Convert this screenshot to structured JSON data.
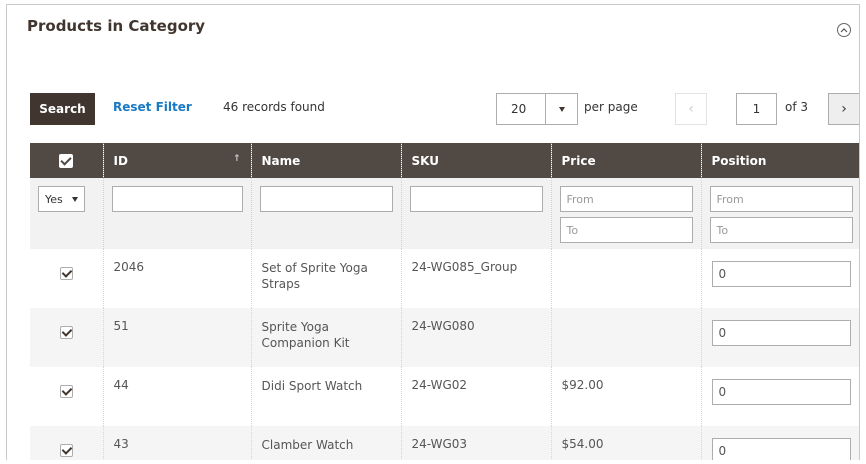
{
  "panel": {
    "title": "Products in Category"
  },
  "toolbar": {
    "search_label": "Search",
    "reset_label": "Reset Filter",
    "records_found": "46 records found",
    "per_page_value": "20",
    "per_page_label": "per page",
    "current_page": "1",
    "of_pages": "of 3"
  },
  "columns": [
    "ID",
    "Name",
    "SKU",
    "Price",
    "Position"
  ],
  "filters": {
    "in_category_value": "Yes",
    "price_from_placeholder": "From",
    "price_to_placeholder": "To",
    "position_from_placeholder": "From",
    "position_to_placeholder": "To"
  },
  "rows": [
    {
      "id": "2046",
      "name": "Set of Sprite Yoga Straps",
      "sku": "24-WG085_Group",
      "price": "",
      "position": "0"
    },
    {
      "id": "51",
      "name": "Sprite Yoga Companion Kit",
      "sku": "24-WG080",
      "price": "",
      "position": "0"
    },
    {
      "id": "44",
      "name": "Didi Sport Watch",
      "sku": "24-WG02",
      "price": "$92.00",
      "position": "0"
    },
    {
      "id": "43",
      "name": "Clamber Watch",
      "sku": "24-WG03",
      "price": "$54.00",
      "position": "0"
    }
  ],
  "icons": {
    "collapse": "chevron-up-circle-icon",
    "prev": "chevron-left-icon",
    "next": "chevron-right-icon",
    "sort": "sort-arrow-up-icon",
    "dropdown": "caret-down-icon"
  },
  "colors": {
    "header_bg": "#514943",
    "button_bg": "#41362f",
    "link": "#1979c3"
  }
}
